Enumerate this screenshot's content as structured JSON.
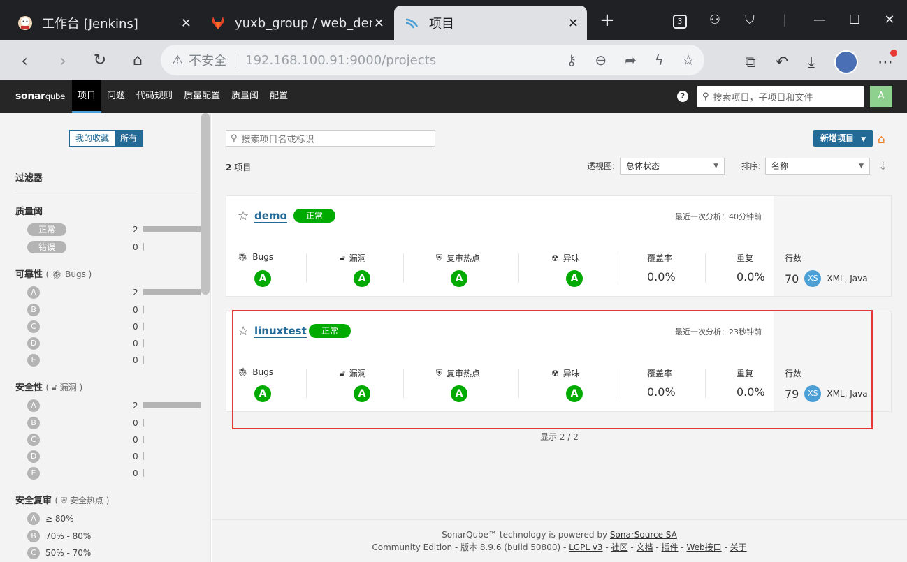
{
  "browser": {
    "tabs": [
      {
        "label": "工作台 [Jenkins]",
        "icon": "jenkins-icon"
      },
      {
        "label": "yuxb_group / web_demo",
        "icon": "gitlab-icon"
      },
      {
        "label": "项目",
        "icon": "sonarqube-icon"
      }
    ],
    "tab_count_badge": "3",
    "url_security": "不安全",
    "url": "192.168.100.91:9000/projects"
  },
  "sonar": {
    "logo_main": "sonar",
    "logo_sub": "qube",
    "menu": [
      "项目",
      "问题",
      "代码规则",
      "质量配置",
      "质量阈",
      "配置"
    ],
    "search_placeholder": "搜索项目，子项目和文件",
    "avatar_letter": "A",
    "help": "?"
  },
  "sidebar": {
    "toggle_favorites": "我的收藏",
    "toggle_all": "所有",
    "filters_title": "过滤器",
    "quality_gate": {
      "title": "质量阈",
      "rows": [
        {
          "label": "正常",
          "count": "2",
          "bar": 1.0
        },
        {
          "label": "错误",
          "count": "0",
          "bar": 0
        }
      ]
    },
    "reliability": {
      "title": "可靠性",
      "sub": "Bugs",
      "rows": [
        {
          "label": "A",
          "count": "2",
          "bar": 1.0
        },
        {
          "label": "B",
          "count": "0",
          "bar": 0
        },
        {
          "label": "C",
          "count": "0",
          "bar": 0
        },
        {
          "label": "D",
          "count": "0",
          "bar": 0
        },
        {
          "label": "E",
          "count": "0",
          "bar": 0
        }
      ]
    },
    "security": {
      "title": "安全性",
      "sub": "漏洞",
      "rows": [
        {
          "label": "A",
          "count": "2",
          "bar": 1.0
        },
        {
          "label": "B",
          "count": "0",
          "bar": 0
        },
        {
          "label": "C",
          "count": "0",
          "bar": 0
        },
        {
          "label": "D",
          "count": "0",
          "bar": 0
        },
        {
          "label": "E",
          "count": "0",
          "bar": 0
        }
      ]
    },
    "security_review": {
      "title": "安全复审",
      "sub": "安全热点",
      "rows": [
        {
          "label": "A",
          "range": "≥ 80%"
        },
        {
          "label": "B",
          "range": "70% - 80%"
        },
        {
          "label": "C",
          "range": "50% - 70%"
        }
      ]
    }
  },
  "main": {
    "search_placeholder": "搜索项目名或标识",
    "new_project": "新增项目",
    "count_number": "2",
    "count_label": "项目",
    "perspective_label": "透视图:",
    "perspective_value": "总体状态",
    "sort_label": "排序:",
    "sort_value": "名称",
    "metric_labels": {
      "bugs": "Bugs",
      "vulns": "漏洞",
      "hotspots": "复审热点",
      "smells": "异味",
      "coverage": "覆盖率",
      "dup": "重复",
      "lines": "行数"
    },
    "projects": [
      {
        "name": "demo",
        "status": "正常",
        "analysis": "最近一次分析：40分钟前",
        "bugs": "A",
        "vulns": "A",
        "hotspots": "A",
        "smells": "A",
        "coverage": "0.0%",
        "dup": "0.0%",
        "lines": "70",
        "size": "XS",
        "langs": "XML, Java"
      },
      {
        "name": "linuxtest",
        "status": "正常",
        "analysis": "最近一次分析：23秒钟前",
        "bugs": "A",
        "vulns": "A",
        "hotspots": "A",
        "smells": "A",
        "coverage": "0.0%",
        "dup": "0.0%",
        "lines": "79",
        "size": "XS",
        "langs": "XML, Java"
      }
    ],
    "shown": "显示 2 / 2"
  },
  "footer": {
    "line1_prefix": "SonarQube™ technology is powered by",
    "line1_link": "SonarSource SA",
    "edition": "Community Edition",
    "version": "版本 8.9.6 (build 50800)",
    "links": [
      "LGPL v3",
      "社区",
      "文档",
      "插件",
      "Web接口",
      "关于"
    ]
  },
  "colors": {
    "accent": "#236a97",
    "ok": "#00aa00",
    "highlight": "#e53935"
  }
}
